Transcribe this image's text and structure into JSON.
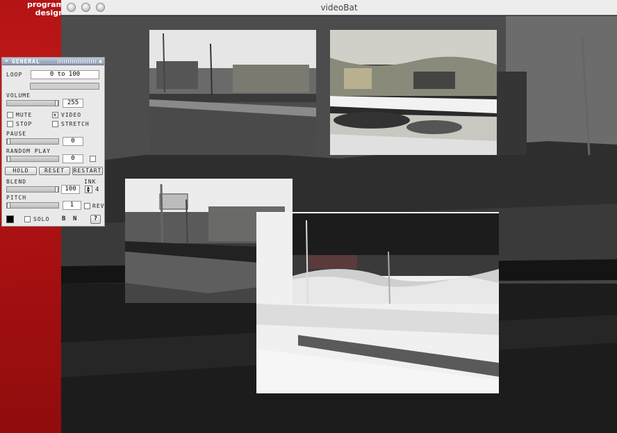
{
  "desktop": {
    "text_line1": "program",
    "text_line2": "design"
  },
  "window": {
    "title": "videoBat"
  },
  "panel": {
    "title": "GENERAL",
    "loop_label": "LOOP",
    "loop_value": "0 to 100",
    "volume_label": "VOLUME",
    "volume_value": "255",
    "mute_label": "MUTE",
    "video_label": "VIDEO",
    "video_checked": true,
    "stop_label": "STOP",
    "stretch_label": "STRETCH",
    "pause_label": "PAUSE",
    "pause_value": "0",
    "random_play_label": "RANDOM PLAY",
    "random_play_value": "0",
    "hold_label": "HOLD",
    "reset_label": "RESET",
    "restart_label": "RESTART",
    "blend_label": "BLEND",
    "blend_value": "100",
    "ink_label": "INK",
    "ink_value": "4",
    "pitch_label": "PITCH",
    "pitch_value": "1",
    "rev_label": "REV",
    "solo_label": "SOLO",
    "b_label": "B",
    "n_label": "N",
    "help_label": "?",
    "levels": {
      "volume": 1.0,
      "pause": 0.0,
      "random_play": 0.0,
      "blend": 1.0,
      "pitch": 0.0
    }
  },
  "colors": {
    "desktop_red": "#a40f10",
    "panel_header": "#8d9ab0"
  }
}
